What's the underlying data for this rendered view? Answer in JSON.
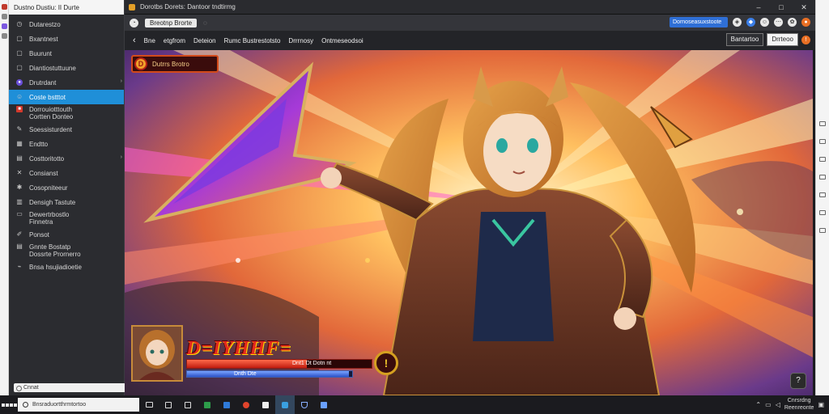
{
  "sidebar": {
    "title": "Dustno Dustiu: II Durte",
    "items": [
      {
        "label": "Dutarestzo",
        "icon": "clock-icon"
      },
      {
        "label": "Bxantnest",
        "icon": "square-outline-icon"
      },
      {
        "label": "Buurunt",
        "icon": "square-outline-icon"
      },
      {
        "label": "Diantiostuttuune",
        "icon": "square-outline-icon"
      },
      {
        "label": "Drutrdant",
        "icon": "avatar-circle-icon"
      },
      {
        "label": "Coste bstttot",
        "icon": "user-icon",
        "active": true
      },
      {
        "label": "Dorrouiotttouth\nCortten Donteo",
        "icon": "red-app-icon"
      },
      {
        "label": "Soessisturdent",
        "icon": "pencil-icon"
      },
      {
        "label": "Endtto",
        "icon": "grid-icon"
      },
      {
        "label": "Costtoritotto",
        "icon": "document-icon"
      },
      {
        "label": "Consianst",
        "icon": "close-icon"
      },
      {
        "label": "Cosopniteeur",
        "icon": "gear-icon"
      },
      {
        "label": "Densigh Tastute",
        "icon": "calendar-icon"
      },
      {
        "label": "Dewertrbostlo\nFinnetra",
        "icon": "window-icon"
      },
      {
        "label": "Ponsot",
        "icon": "brush-icon"
      },
      {
        "label": "Gnnte Bostatp\nDossrte Prornerro",
        "icon": "document-icon"
      },
      {
        "label": "Bnsa hsujiadioetie",
        "icon": "plug-icon"
      }
    ],
    "search_text": "Cnnat"
  },
  "main": {
    "title": "Dorotbs Dorets: Dantoor tndtirmg",
    "tab": "Breotnp Brorte",
    "url": "Dornoseasuxstoote",
    "nav": [
      "Bne",
      "etgfrom",
      "Deteion",
      "Rumc Bustrestotsto",
      "Drrrnosy",
      "Ontmeseodsoi"
    ],
    "right_box": "Bantartoo",
    "right_input": "Drrteoo",
    "window_controls": [
      "–",
      "□",
      "✕"
    ]
  },
  "game": {
    "level_badge": "Dutrrs Brotro",
    "level_icon": "D",
    "player_name": "D=IYHHF=",
    "hp_text": "Dnt1 Dt Dotn nt",
    "hp_fraction": 0.65,
    "mp_text": "Dnth Dte",
    "mp_fraction": 0.98,
    "rank_badge": "!",
    "corner_button": "?"
  },
  "taskbar": {
    "search_placeholder": "Bnsraduortthrmtortoo",
    "clock_time": "Cnrsrdng",
    "clock_date": "Reenreonte"
  }
}
